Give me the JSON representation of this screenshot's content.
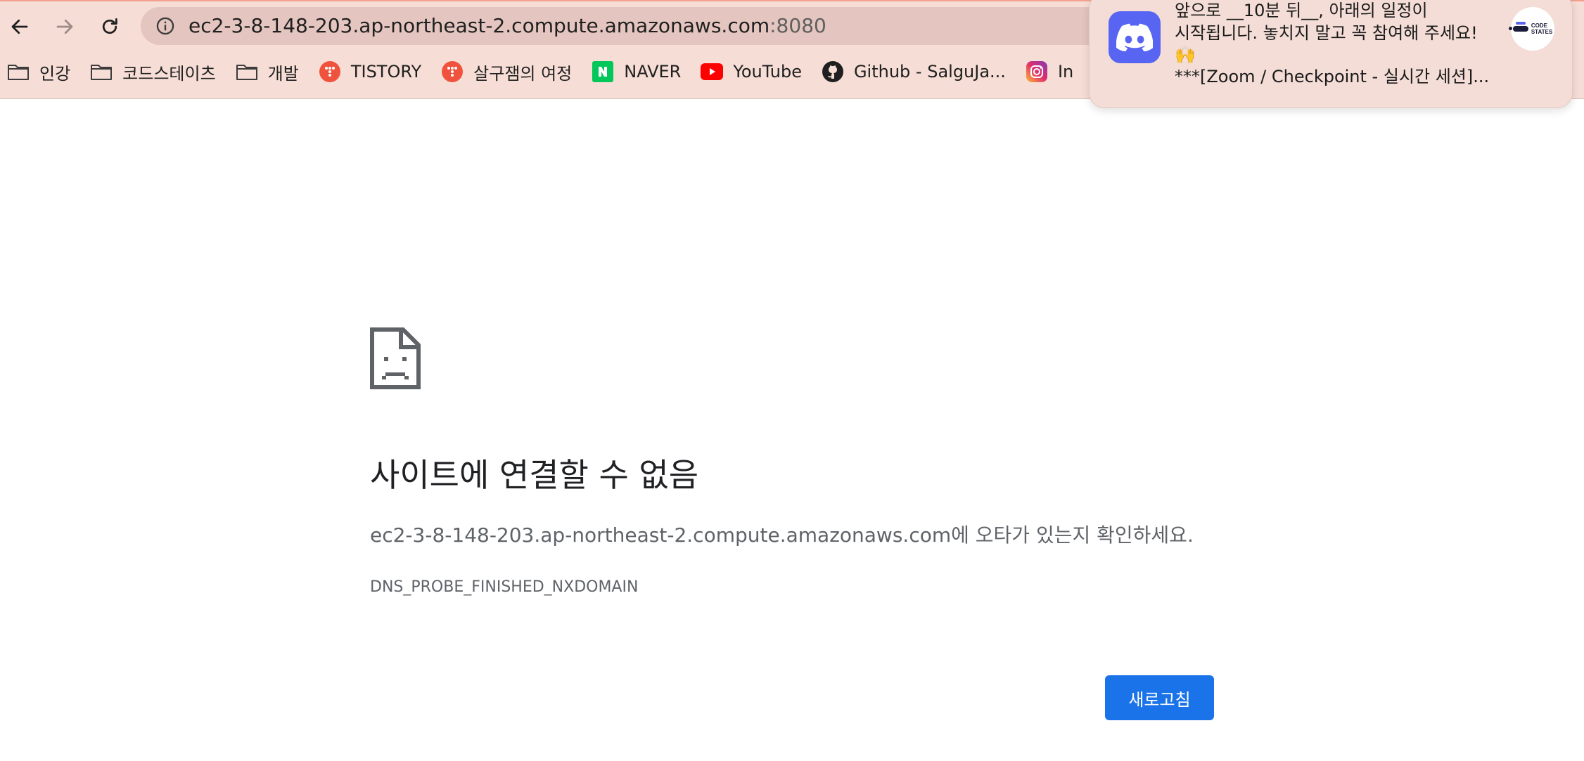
{
  "browser": {
    "url_host": "ec2-3-8-148-203.ap-northeast-2.compute.amazonaws.com",
    "url_port": ":8080",
    "bookmarks": [
      {
        "label": "인강",
        "icon": "folder-icon"
      },
      {
        "label": "코드스테이츠",
        "icon": "folder-icon"
      },
      {
        "label": "개발",
        "icon": "folder-icon"
      },
      {
        "label": "TISTORY",
        "icon": "tistory-icon"
      },
      {
        "label": "살구잼의 여정",
        "icon": "tistory-icon"
      },
      {
        "label": "NAVER",
        "icon": "naver-icon"
      },
      {
        "label": "YouTube",
        "icon": "youtube-icon"
      },
      {
        "label": "Github - SalguJa...",
        "icon": "github-icon"
      },
      {
        "label": "In",
        "icon": "instagram-icon"
      }
    ]
  },
  "notification": {
    "app": "Discord",
    "line1": "앞으로 __10분 뒤__, 아래의 일정이",
    "line2": "시작됩니다. 놓치지 말고 꼭 참여해 주세요!",
    "emoji": "🙌",
    "line3": "***[Zoom / Checkpoint - 실시간 세션]...",
    "avatar_text_top": "CODE",
    "avatar_text_bottom": "STATES"
  },
  "error": {
    "title": "사이트에 연결할 수 없음",
    "description": "ec2-3-8-148-203.ap-northeast-2.compute.amazonaws.com에 오타가 있는지 확인하세요.",
    "code": "DNS_PROBE_FINISHED_NXDOMAIN",
    "reload_label": "새로고침"
  },
  "colors": {
    "chrome_bg": "#f6ddd6",
    "omnibox_bg": "#e4c5bf",
    "reload_button": "#1a73e8",
    "discord": "#5865f2"
  }
}
